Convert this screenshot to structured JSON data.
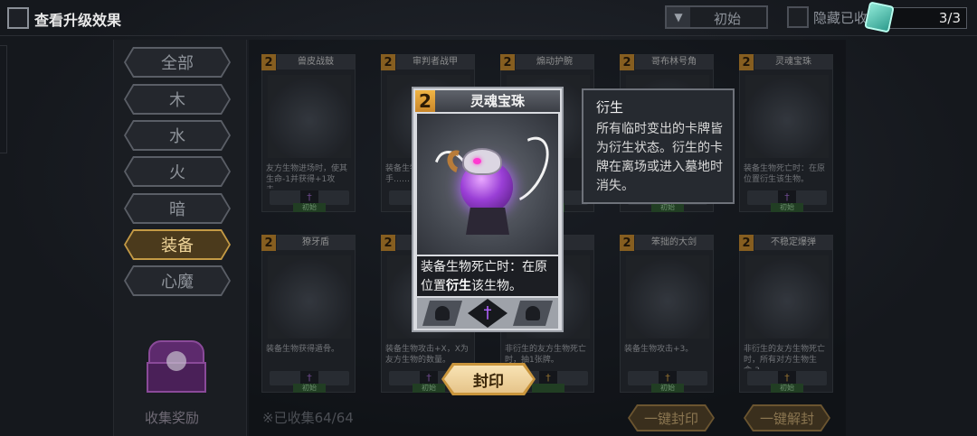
{
  "header": {
    "view_upgrade_label": "查看升级效果",
    "sort_label": "初始",
    "hide_label": "隐藏已收",
    "count": "3/3"
  },
  "categories": [
    "全部",
    "木",
    "水",
    "火",
    "暗",
    "装备",
    "心魔"
  ],
  "active_category": "装备",
  "chest_label": "收集奖励",
  "collected_text": "※已收集64/64",
  "cards": [
    {
      "cost": "2",
      "name": "兽皮战鼓",
      "desc": "友方生物进场时，使其生命-1并获得+1攻击。",
      "tag": "初始"
    },
    {
      "cost": "2",
      "name": "审判者战甲",
      "desc": "装备生物……使对手……",
      "tag": "初始"
    },
    {
      "cost": "2",
      "name": "煽动护腕",
      "desc": "…其他…，直…",
      "tag": "初始"
    },
    {
      "cost": "2",
      "name": "哥布林号角",
      "desc": "",
      "tag": "初始"
    },
    {
      "cost": "2",
      "name": "灵魂宝珠",
      "desc": "装备生物死亡时：在原位置衍生该生物。",
      "tag": "初始"
    },
    {
      "cost": "2",
      "name": "獠牙盾",
      "desc": "装备生物获得遁骨。",
      "tag": "初始"
    },
    {
      "cost": "2",
      "name": "",
      "desc": "装备生物攻击+X，X为友方生物的数量。",
      "tag": "初始"
    },
    {
      "cost": "",
      "name": "",
      "desc": "非衍生的友方生物死亡时，抽1张牌。",
      "tag": ""
    },
    {
      "cost": "2",
      "name": "笨拙的大剑",
      "desc": "装备生物攻击+3。",
      "tag": "初始"
    },
    {
      "cost": "2",
      "name": "不稳定爆弹",
      "desc": "非衍生的友方生物死亡时，所有对方生物生命-3。",
      "tag": "初始"
    }
  ],
  "buttons": {
    "seal_all": "一键封印",
    "unseal_all": "一键解封",
    "seal": "封印"
  },
  "popup": {
    "cost": "2",
    "name": "灵魂宝珠",
    "desc_prefix": "装备生物死亡时：在原位置",
    "desc_keyword": "衍生",
    "desc_suffix": "该生物。"
  },
  "tooltip": {
    "title": "衍生",
    "body": "所有临时变出的卡牌皆为衍生状态。衍生的卡牌在离场或进入墓地时消失。"
  }
}
